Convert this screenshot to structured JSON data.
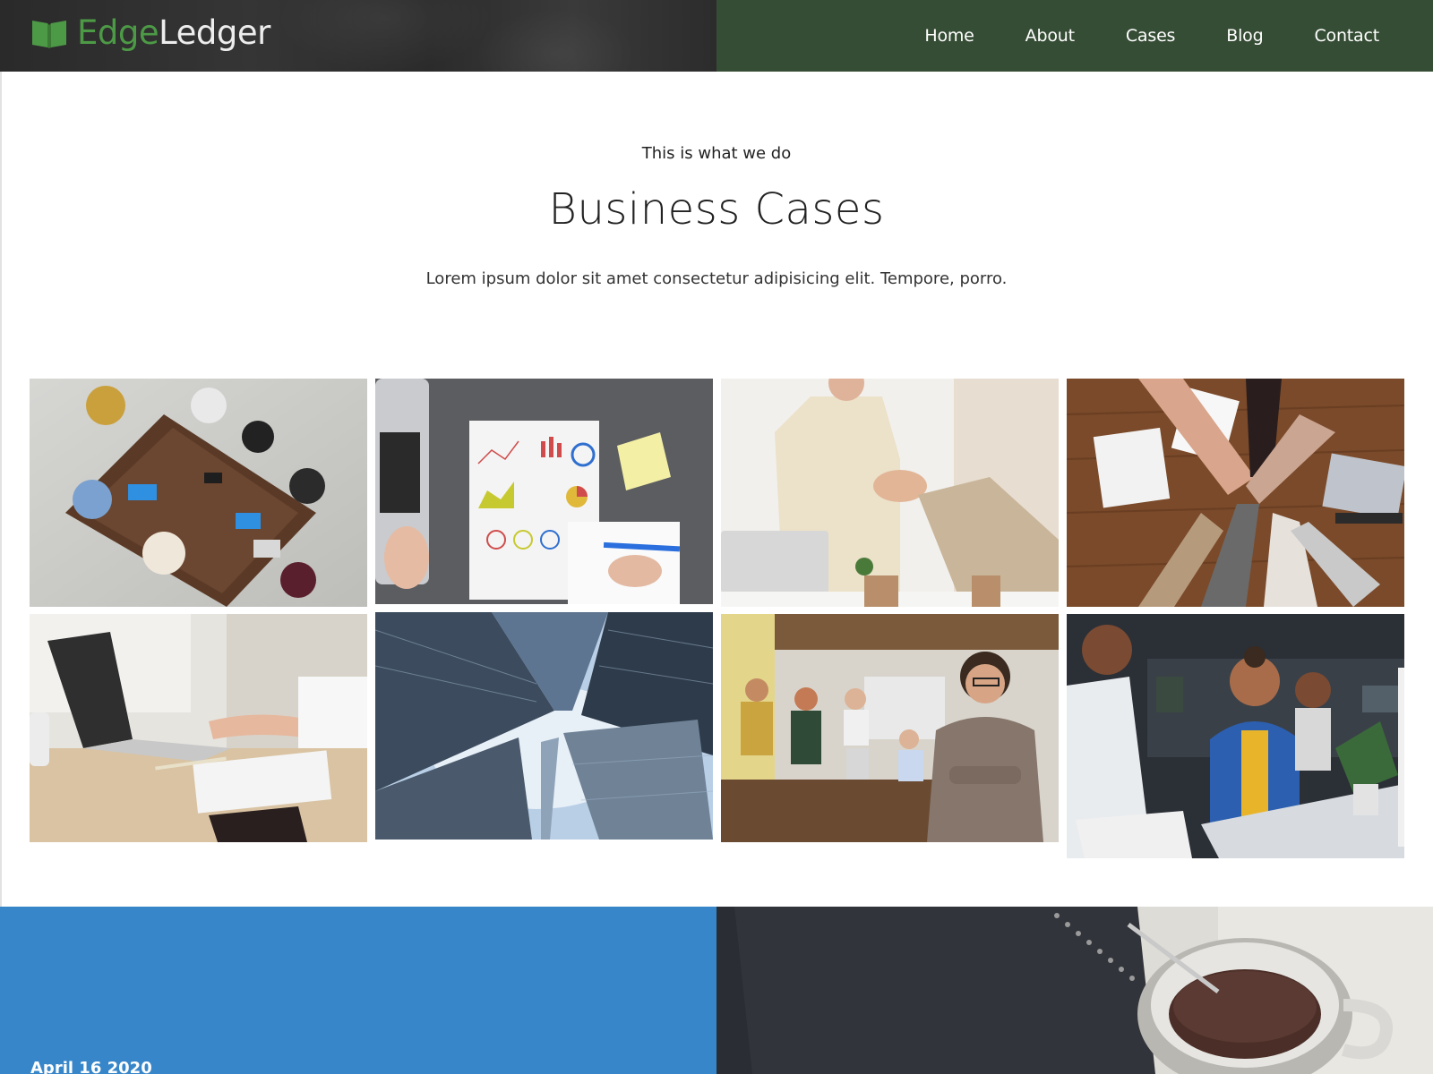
{
  "header": {
    "logo": {
      "part1": "Edge",
      "part2": "Ledger",
      "icon": "open-book-icon"
    },
    "nav": [
      {
        "label": "Home"
      },
      {
        "label": "About"
      },
      {
        "label": "Cases"
      },
      {
        "label": "Blog"
      },
      {
        "label": "Contact"
      }
    ]
  },
  "intro": {
    "eyebrow": "This is what we do",
    "heading": "Business Cases",
    "lede": "Lorem ipsum dolor sit amet consectetur adipisicing elit. Tempore, porro."
  },
  "gallery": {
    "images": [
      {
        "subject": "team-meeting-overhead"
      },
      {
        "subject": "charts-and-laptop"
      },
      {
        "subject": "handshake"
      },
      {
        "subject": "team-hands-stack"
      },
      {
        "subject": "laptop-typing"
      },
      {
        "subject": "skyscrapers"
      },
      {
        "subject": "team-leader-portrait"
      },
      {
        "subject": "smiling-office-worker"
      }
    ]
  },
  "blog": {
    "date": "April 16 2020"
  },
  "colors": {
    "brand_green": "#4d9a46",
    "nav_green": "#364d35",
    "accent_blue": "#3786c9"
  }
}
